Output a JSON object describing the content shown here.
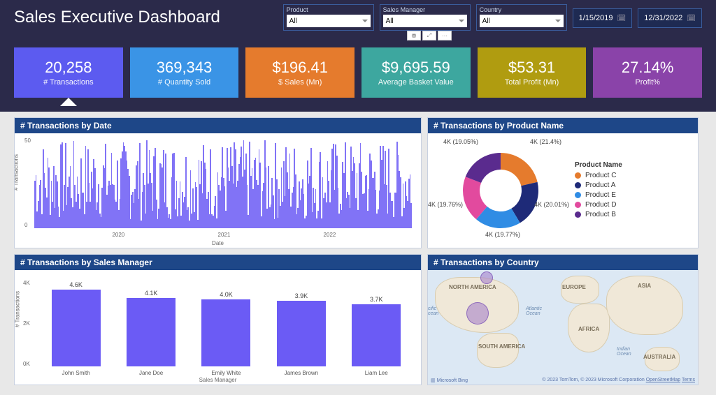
{
  "title": "Sales Executive Dashboard",
  "filters": {
    "product": {
      "label": "Product",
      "value": "All"
    },
    "sales_manager": {
      "label": "Sales Manager",
      "value": "All"
    },
    "country": {
      "label": "Country",
      "value": "All"
    }
  },
  "date_range": {
    "start": "1/15/2019",
    "end": "12/31/2022"
  },
  "kpis": {
    "transactions": {
      "value": "20,258",
      "label": "# Transactions"
    },
    "quantity": {
      "value": "369,343",
      "label": "# Quantity Sold"
    },
    "sales": {
      "value": "$196.41",
      "label": "$ Sales (Mn)"
    },
    "basket": {
      "value": "$9,695.59",
      "label": "Average Basket Value"
    },
    "profit": {
      "value": "$53.31",
      "label": "Total Profit (Mn)"
    },
    "profit_pct": {
      "value": "27.14%",
      "label": "Profit%"
    }
  },
  "cards": {
    "by_date": {
      "title": "# Transactions by Date",
      "ylabel": "# Transactions",
      "xlabel": "Date"
    },
    "by_product": {
      "title": "# Transactions by Product Name",
      "legend_title": "Product Name"
    },
    "by_manager": {
      "title": "# Transactions by Sales Manager",
      "ylabel": "# Transactions",
      "xlabel": "Sales Manager"
    },
    "by_country": {
      "title": "# Transactions by Country"
    }
  },
  "map_attrib": {
    "bing": "Microsoft Bing",
    "text": "© 2023 TomTom, © 2023 Microsoft Corporation",
    "osm": "OpenStreetMap",
    "terms": "Terms"
  },
  "map_labels": {
    "na": "NORTH AMERICA",
    "eu": "EUROPE",
    "asia": "ASIA",
    "africa": "AFRICA",
    "sa": "SOUTH AMERICA",
    "aus": "AUSTRALIA",
    "pacific": "cific\ncean",
    "atlantic": "Atlantic\nOcean",
    "indian": "Indian\nOcean"
  },
  "chart_data": [
    {
      "id": "transactions_by_date",
      "type": "area",
      "title": "# Transactions by Date",
      "xlabel": "Date",
      "ylabel": "# Transactions",
      "ylim": [
        0,
        50
      ],
      "x_ticks": [
        "2020",
        "2021",
        "2022"
      ],
      "y_ticks": [
        0,
        50
      ],
      "note": "Daily counts 2019-01-15 to 2022-12-31; dense noisy series ranging roughly 2–50"
    },
    {
      "id": "transactions_by_product",
      "type": "pie",
      "title": "# Transactions by Product Name",
      "series": [
        {
          "name": "Product C",
          "value": 4000,
          "pct": 21.4,
          "label": "4K (21.4%)",
          "color": "#e57b2d"
        },
        {
          "name": "Product A",
          "value": 4000,
          "pct": 20.01,
          "label": "4K (20.01%)",
          "color": "#1e2a78"
        },
        {
          "name": "Product E",
          "value": 4000,
          "pct": 19.77,
          "label": "4K (19.77%)",
          "color": "#2f8ce4"
        },
        {
          "name": "Product D",
          "value": 4000,
          "pct": 19.76,
          "label": "4K (19.76%)",
          "color": "#e24a9e"
        },
        {
          "name": "Product B",
          "value": 4000,
          "pct": 19.05,
          "label": "4K (19.05%)",
          "color": "#5a2b8e"
        }
      ]
    },
    {
      "id": "transactions_by_sales_manager",
      "type": "bar",
      "title": "# Transactions by Sales Manager",
      "xlabel": "Sales Manager",
      "ylabel": "# Transactions",
      "ylim": [
        0,
        5000
      ],
      "y_ticks": [
        "0K",
        "2K",
        "4K"
      ],
      "categories": [
        "John Smith",
        "Jane Doe",
        "Emily White",
        "James Brown",
        "Liam Lee"
      ],
      "values": [
        4600,
        4100,
        4000,
        3900,
        3700
      ],
      "value_labels": [
        "4.6K",
        "4.1K",
        "4.0K",
        "3.9K",
        "3.7K"
      ]
    },
    {
      "id": "transactions_by_country",
      "type": "map",
      "title": "# Transactions by Country",
      "note": "Bubble map; two visible bubbles – one near northern North America / Greenland and a larger one over central USA"
    }
  ]
}
